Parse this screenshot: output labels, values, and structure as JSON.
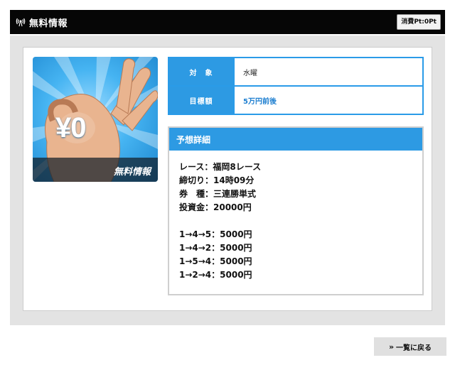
{
  "header": {
    "title": "無料情報",
    "points_badge": "消費Pt:0Pt",
    "icon": "wave-icon"
  },
  "hero": {
    "price_text": "¥0",
    "caption": "無料情報"
  },
  "info": {
    "rows": [
      {
        "label": "対　象",
        "value": "水曜"
      },
      {
        "label": "目標額",
        "value": "5万円前後"
      }
    ]
  },
  "detail": {
    "title": "予想詳細",
    "race_lines": [
      "レース：福岡8レース",
      "締切り：14時09分",
      "券　種：三連勝単式",
      "投資金：20000円"
    ],
    "bet_lines": [
      "1→4→5：5000円",
      "1→4→2：5000円",
      "1→5→4：5000円",
      "1→2→4：5000円"
    ]
  },
  "back_button": {
    "icon": "chevron-double-right-icon",
    "label": "一覧に戻る"
  },
  "colors": {
    "accent_blue": "#2d9ae3",
    "header_bg": "#060606",
    "panel_gray": "#e3e3e3"
  }
}
